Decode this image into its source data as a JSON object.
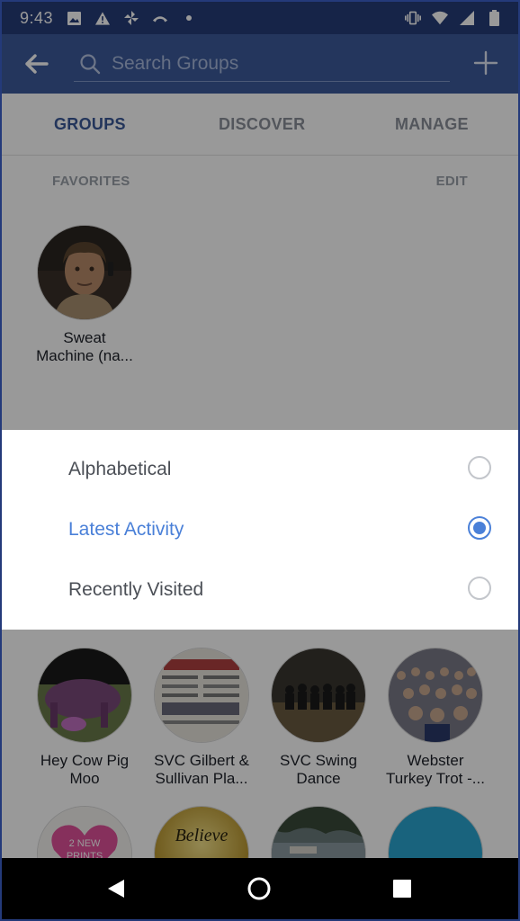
{
  "status_bar": {
    "time": "9:43",
    "icons_left": [
      "image-icon",
      "alert-icon",
      "pinwheel-icon",
      "missed-call-icon",
      "dot-icon"
    ],
    "icons_right": [
      "vibrate-icon",
      "wifi-icon",
      "signal-icon",
      "battery-icon"
    ]
  },
  "app_bar": {
    "search_placeholder": "Search Groups"
  },
  "tabs": [
    {
      "label": "GROUPS",
      "active": true
    },
    {
      "label": "DISCOVER",
      "active": false
    },
    {
      "label": "MANAGE",
      "active": false
    }
  ],
  "favorites": {
    "title": "FAVORITES",
    "edit_label": "EDIT",
    "items": [
      {
        "name_line1": "Sweat",
        "name_line2": "Machine (na..."
      }
    ]
  },
  "sort_sheet": {
    "options": [
      {
        "label": "Alphabetical",
        "selected": false
      },
      {
        "label": "Latest Activity",
        "selected": true
      },
      {
        "label": "Recently Visited",
        "selected": false
      }
    ]
  },
  "groups": [
    {
      "name_line1": "Hey Cow Pig",
      "name_line2": "Moo"
    },
    {
      "name_line1": "SVC Gilbert &",
      "name_line2": "Sullivan Pla..."
    },
    {
      "name_line1": "SVC Swing",
      "name_line2": "Dance"
    },
    {
      "name_line1": "Webster",
      "name_line2": "Turkey Trot -..."
    }
  ],
  "more_groups_visible_text": [
    "2 NEW PRINTS",
    "Believe"
  ],
  "colors": {
    "status_bar": "#253c78",
    "app_bar": "#3c5b9b",
    "accent": "#4a80d8",
    "tab_active": "#3b5998"
  }
}
